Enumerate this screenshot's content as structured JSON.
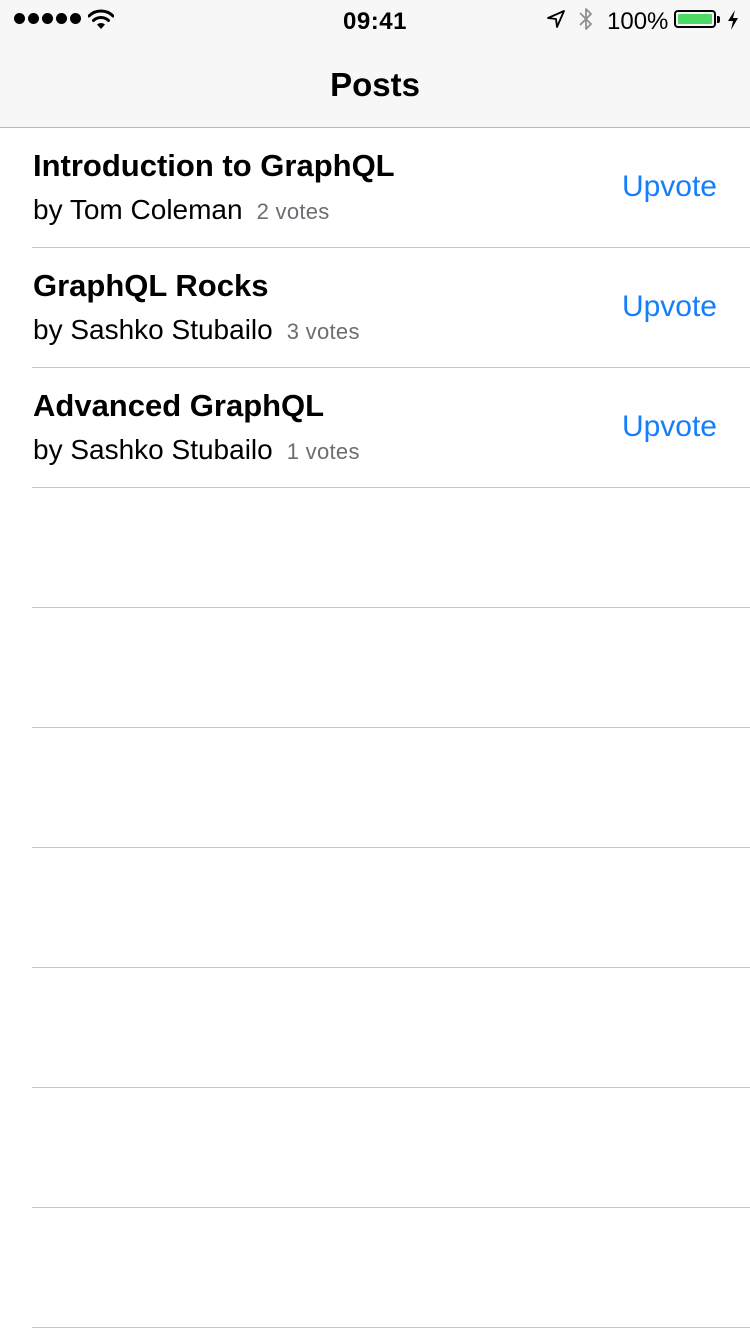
{
  "status_bar": {
    "time": "09:41",
    "battery_percent": "100%",
    "battery_level": 1.0,
    "icons": [
      "signal-dots-icon",
      "wifi-icon",
      "location-arrow-icon",
      "bluetooth-icon",
      "battery-icon",
      "charging-bolt-icon"
    ]
  },
  "nav": {
    "title": "Posts"
  },
  "posts": [
    {
      "title": "Introduction to GraphQL",
      "author": "by Tom Coleman",
      "votes": "2 votes",
      "action": "Upvote"
    },
    {
      "title": "GraphQL Rocks",
      "author": "by Sashko Stubailo",
      "votes": "3 votes",
      "action": "Upvote"
    },
    {
      "title": "Advanced GraphQL",
      "author": "by Sashko Stubailo",
      "votes": "1 votes",
      "action": "Upvote"
    }
  ],
  "colors": {
    "accent": "#157efb",
    "battery_fill": "#4cd964",
    "separator": "#c8c7cc",
    "secondary_text": "#6d6d72",
    "bar_background": "#f7f7f7"
  }
}
